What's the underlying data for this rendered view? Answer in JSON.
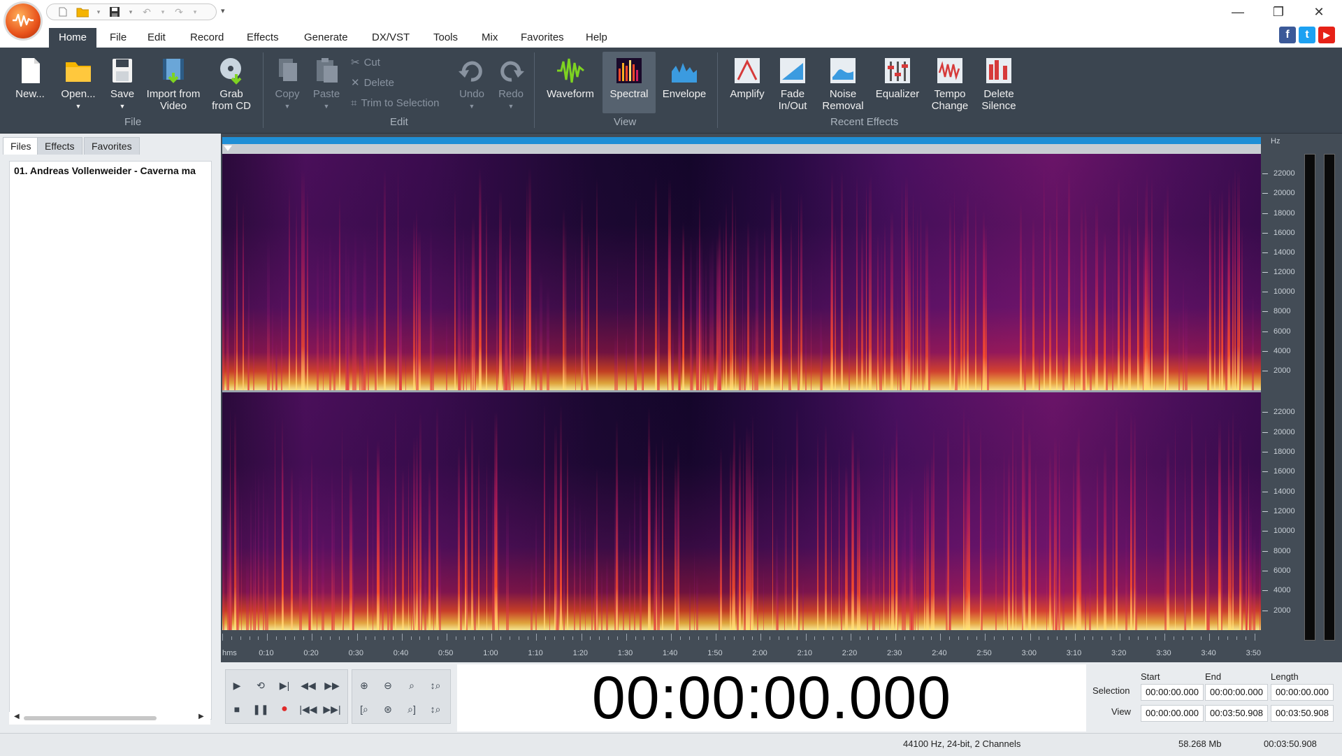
{
  "app": {
    "window_controls": [
      "—",
      "❐",
      "✕"
    ],
    "social": [
      {
        "name": "facebook",
        "glyph": "f",
        "color": "#3b5998"
      },
      {
        "name": "twitter",
        "glyph": "t",
        "color": "#1da1f2"
      },
      {
        "name": "youtube",
        "glyph": "▶",
        "color": "#e62117"
      }
    ]
  },
  "menu": [
    "Home",
    "File",
    "Edit",
    "Record",
    "Effects",
    "Generate",
    "DX/VST",
    "Tools",
    "Mix",
    "Favorites",
    "Help"
  ],
  "ribbon": {
    "file": {
      "new": "New...",
      "open": "Open...",
      "save": "Save",
      "import_video": "Import from Video",
      "grab_cd": "Grab from CD",
      "group": "File"
    },
    "edit": {
      "copy": "Copy",
      "paste": "Paste",
      "cut": "Cut",
      "delete": "Delete",
      "trim": "Trim to Selection",
      "undo": "Undo",
      "redo": "Redo",
      "group": "Edit"
    },
    "view": {
      "waveform": "Waveform",
      "spectral": "Spectral",
      "envelope": "Envelope",
      "group": "View"
    },
    "recent": {
      "amplify": "Amplify",
      "fade": "Fade In/Out",
      "noise": "Noise Removal",
      "equalizer": "Equalizer",
      "tempo": "Tempo Change",
      "silence": "Delete Silence",
      "group": "Recent Effects"
    }
  },
  "left_panel": {
    "tabs": [
      "Files",
      "Effects",
      "Favorites"
    ],
    "files": [
      "01. Andreas Vollenweider - Caverna ma"
    ]
  },
  "freq_ruler": {
    "unit": "Hz",
    "labels": [
      "22000",
      "20000",
      "18000",
      "16000",
      "14000",
      "12000",
      "10000",
      "8000",
      "6000",
      "4000",
      "2000"
    ]
  },
  "time_ruler": {
    "unit": "hms",
    "labels": [
      "0:10",
      "0:20",
      "0:30",
      "0:40",
      "0:50",
      "1:00",
      "1:10",
      "1:20",
      "1:30",
      "1:40",
      "1:50",
      "2:00",
      "2:10",
      "2:20",
      "2:30",
      "2:40",
      "2:50",
      "3:00",
      "3:10",
      "3:20",
      "3:30",
      "3:40",
      "3:50"
    ]
  },
  "transport": {
    "row1": [
      "play-icon",
      "loop-icon",
      "play-to-end-icon",
      "rewind-icon",
      "fast-forward-icon"
    ],
    "row2": [
      "stop-icon",
      "pause-icon",
      "record-icon",
      "go-to-start-icon",
      "go-to-end-icon"
    ]
  },
  "time_display": "00:00:00.000",
  "selection_panel": {
    "headers": {
      "start": "Start",
      "end": "End",
      "length": "Length"
    },
    "selection": {
      "label": "Selection",
      "start": "00:00:00.000",
      "end": "00:00:00.000",
      "length": "00:00:00.000"
    },
    "view": {
      "label": "View",
      "start": "00:00:00.000",
      "end": "00:03:50.908",
      "length": "00:03:50.908"
    }
  },
  "status": {
    "format": "44100 Hz, 24-bit, 2 Channels",
    "size": "58.268 Mb",
    "duration": "00:03:50.908"
  },
  "colors": {
    "ribbon": "#3b4550",
    "overview": "#1f8fd6",
    "accent": "#e8521b"
  }
}
